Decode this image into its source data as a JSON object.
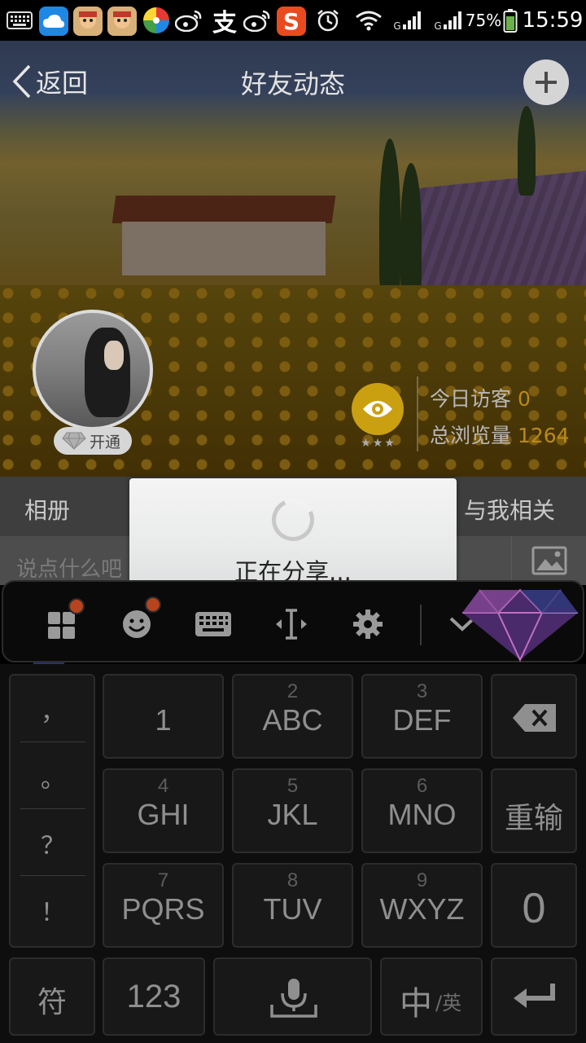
{
  "status_bar": {
    "battery_percent": "75%",
    "time": "15:59",
    "signal_label_1": "G",
    "signal_label_2": "G",
    "sogou_letter": "S",
    "alipay_glyph": "支",
    "icons": [
      "keyboard-icon",
      "cloud-icon",
      "game-app-icon",
      "game-app-icon",
      "pinwheel-icon",
      "weibo-icon",
      "alipay-icon",
      "weibo-icon",
      "sogou-icon",
      "alarm-icon",
      "wifi-icon",
      "signal-icon",
      "signal-icon",
      "battery-icon"
    ]
  },
  "header": {
    "back_label": "返回",
    "title": "好友动态"
  },
  "profile": {
    "vip_label": "开通",
    "rating_stars": "★★★",
    "today_visitors_label": "今日访客",
    "today_visitors_value": "0",
    "total_views_label": "总浏览量",
    "total_views_value": "1264"
  },
  "tabs": {
    "album": "相册",
    "related": "与我相关"
  },
  "composer": {
    "placeholder": "说点什么吧"
  },
  "dialog": {
    "message": "正在分享..."
  },
  "keyboard": {
    "punctuation": [
      "，",
      "。",
      "？",
      "！"
    ],
    "keys": [
      {
        "main": "1",
        "sub": ""
      },
      {
        "main": "ABC",
        "sub": "2"
      },
      {
        "main": "DEF",
        "sub": "3"
      },
      {
        "main": "GHI",
        "sub": "4"
      },
      {
        "main": "JKL",
        "sub": "5"
      },
      {
        "main": "MNO",
        "sub": "6"
      },
      {
        "main": "PQRS",
        "sub": "7"
      },
      {
        "main": "TUV",
        "sub": "8"
      },
      {
        "main": "WXYZ",
        "sub": "9"
      }
    ],
    "retype": "重输",
    "zero": "0",
    "symbols": "符",
    "numbers": "123",
    "lang_main": "中",
    "lang_sub": "/英"
  },
  "colors": {
    "accent_gold": "#caa011",
    "stat_value": "#b98a1a",
    "notification_dot": "#b5441f",
    "sogou_brand": "#ea4b1e"
  }
}
